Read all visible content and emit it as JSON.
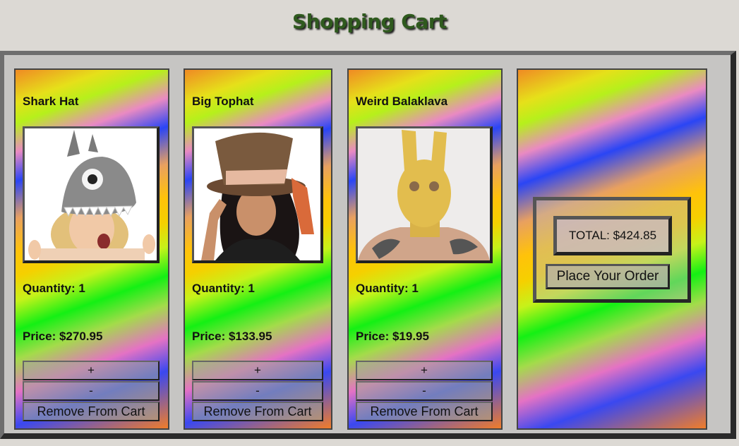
{
  "page": {
    "title": "Shopping Cart"
  },
  "items": [
    {
      "name": "Shark Hat",
      "quantity": "Quantity: 1",
      "price": "Price: $270.95",
      "plus": "+",
      "minus": "-",
      "remove": "Remove From Cart"
    },
    {
      "name": "Big Tophat",
      "quantity": "Quantity: 1",
      "price": "Price: $133.95",
      "plus": "+",
      "minus": "-",
      "remove": "Remove From Cart"
    },
    {
      "name": "Weird Balaklava",
      "quantity": "Quantity: 1",
      "price": "Price: $19.95",
      "plus": "+",
      "minus": "-",
      "remove": "Remove From Cart"
    }
  ],
  "summary": {
    "total": "TOTAL: $424.85",
    "order_button": "Place Your Order"
  },
  "colors": {
    "title": "#2f5a1e",
    "background": "#dcd9d4",
    "frame": "#c6c5c3"
  }
}
